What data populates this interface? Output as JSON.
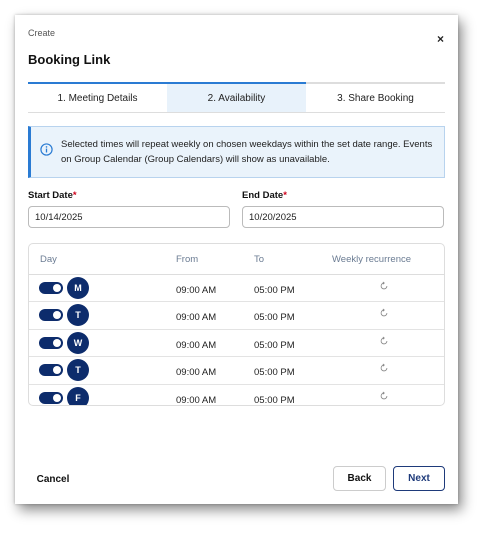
{
  "dialog": {
    "pre_title": "Create",
    "title": "Booking Link",
    "close_glyph": "×"
  },
  "tabs": [
    {
      "label": "1. Meeting Details",
      "state": "completed"
    },
    {
      "label": "2. Availability",
      "state": "active"
    },
    {
      "label": "3. Share Booking",
      "state": "pending"
    }
  ],
  "info": {
    "text": "Selected times will repeat weekly on chosen weekdays within the set date range. Events on Group Calendar (Group Calendars) will show as unavailable.",
    "icon": "info-circle-icon"
  },
  "start_date": {
    "label": "Start Date",
    "required": "*",
    "value": "10/14/2025"
  },
  "end_date": {
    "label": "End Date",
    "required": "*",
    "value": "10/20/2025"
  },
  "schedule": {
    "headers": {
      "day": "Day",
      "from": "From",
      "to": "To",
      "recurrence": "Weekly recurrence"
    },
    "rows": [
      {
        "day": "M",
        "enabled": true,
        "from": "09:00 AM",
        "to": "05:00 PM"
      },
      {
        "day": "T",
        "enabled": true,
        "from": "09:00 AM",
        "to": "05:00 PM"
      },
      {
        "day": "W",
        "enabled": true,
        "from": "09:00 AM",
        "to": "05:00 PM"
      },
      {
        "day": "T",
        "enabled": true,
        "from": "09:00 AM",
        "to": "05:00 PM"
      },
      {
        "day": "F",
        "enabled": true,
        "from": "09:00 AM",
        "to": "05:00 PM"
      }
    ]
  },
  "footer": {
    "cancel": "Cancel",
    "back": "Back",
    "next": "Next"
  },
  "colors": {
    "accent": "#2a7bd3",
    "navy": "#0d2c6c",
    "required": "#d0021b"
  }
}
